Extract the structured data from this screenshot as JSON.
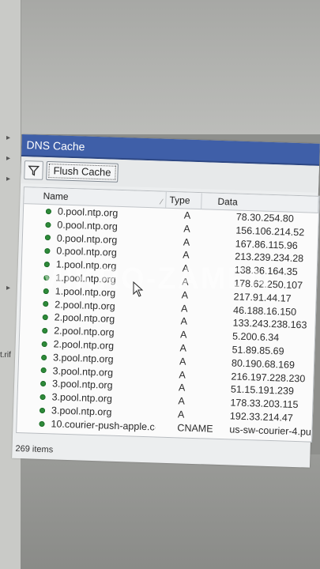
{
  "window": {
    "title": "DNS Cache"
  },
  "toolbar": {
    "flush_label": "Flush Cache"
  },
  "table": {
    "columns": [
      "Name",
      "Type",
      "Data"
    ],
    "rows": [
      {
        "name": "0.pool.ntp.org",
        "type": "A",
        "data": "78.30.254.80"
      },
      {
        "name": "0.pool.ntp.org",
        "type": "A",
        "data": "156.106.214.52"
      },
      {
        "name": "0.pool.ntp.org",
        "type": "A",
        "data": "167.86.115.96"
      },
      {
        "name": "0.pool.ntp.org",
        "type": "A",
        "data": "213.239.234.28"
      },
      {
        "name": "1.pool.ntp.org",
        "type": "A",
        "data": "138.36.164.35"
      },
      {
        "name": "1.pool.ntp.org",
        "type": "A",
        "data": "178.62.250.107"
      },
      {
        "name": "1.pool.ntp.org",
        "type": "A",
        "data": "217.91.44.17"
      },
      {
        "name": "2.pool.ntp.org",
        "type": "A",
        "data": "46.188.16.150"
      },
      {
        "name": "2.pool.ntp.org",
        "type": "A",
        "data": "133.243.238.163"
      },
      {
        "name": "2.pool.ntp.org",
        "type": "A",
        "data": "5.200.6.34"
      },
      {
        "name": "2.pool.ntp.org",
        "type": "A",
        "data": "51.89.85.69"
      },
      {
        "name": "3.pool.ntp.org",
        "type": "A",
        "data": "80.190.68.169"
      },
      {
        "name": "3.pool.ntp.org",
        "type": "A",
        "data": "216.197.228.230"
      },
      {
        "name": "3.pool.ntp.org",
        "type": "A",
        "data": "51.15.191.239"
      },
      {
        "name": "3.pool.ntp.org",
        "type": "A",
        "data": "178.33.203.115"
      },
      {
        "name": "3.pool.ntp.org",
        "type": "A",
        "data": "192.33.214.47"
      },
      {
        "name": "10.courier-push-apple.co...",
        "type": "CNAME",
        "data": "us-sw-courier-4.push-ap"
      }
    ]
  },
  "status": {
    "items": "269 items"
  },
  "watermark": {
    "text": "MIKRO-ZAMEN"
  },
  "side": {
    "file_label": "t.rif"
  },
  "icons": {
    "filter": "filter-funnel-icon",
    "row": "status-dot-icon",
    "cursor": "mouse-pointer-icon"
  },
  "colors": {
    "titlebar": "#3f5fa8",
    "dot": "#2e8b3a"
  }
}
